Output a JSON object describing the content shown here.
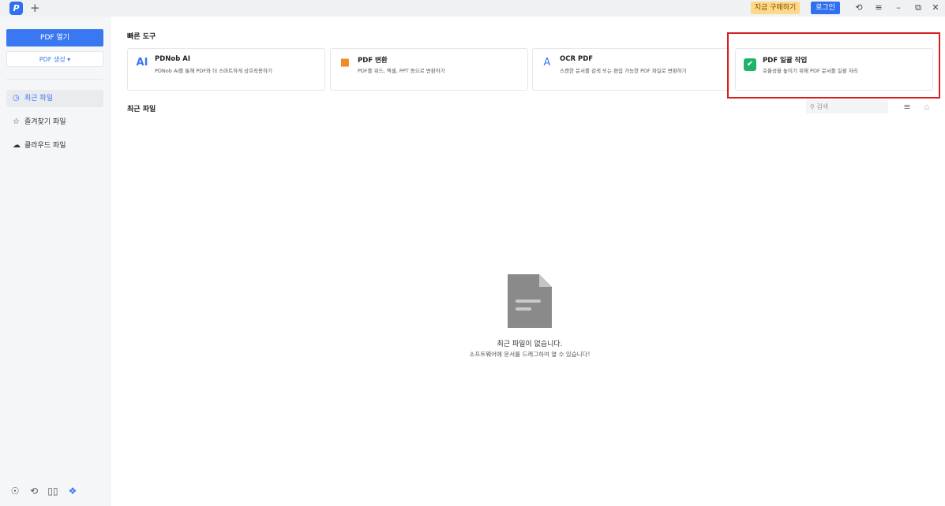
{
  "titlebar": {
    "logo": "P",
    "new_tab": "+",
    "buy_label": "지금 구매하기",
    "login_label": "로그인",
    "icons": [
      "support-icon",
      "menu-icon",
      "minimize-icon",
      "restore-icon",
      "close-icon"
    ],
    "icon_glyphs": [
      "⟲",
      "≡",
      "–",
      "⧉",
      "✕"
    ]
  },
  "sidebar": {
    "open_label": "PDF 열기",
    "create_label": "PDF 생성 ▾",
    "nav": [
      {
        "icon": "◷",
        "label": "최근 파일"
      },
      {
        "icon": "☆",
        "label": "즐겨찾기 파일"
      },
      {
        "icon": "☁",
        "label": "클라우드 파일"
      }
    ],
    "bottom_icons": [
      "☉",
      "⟲",
      "▯▯",
      "❖"
    ]
  },
  "quick_tools": {
    "title": "빠른 도구",
    "cards": [
      {
        "icon": "AI",
        "title": "PDNob AI",
        "desc": "PDNob AI를 통해 PDF와 더 스마트하게 상호작용하기",
        "color": "#3a78f2"
      },
      {
        "icon": "■",
        "title": "PDF 변환",
        "desc": "PDF를 워드, 엑셀, PPT 등으로 변환하기",
        "color": "#f08a24"
      },
      {
        "icon": "A",
        "title": "OCR PDF",
        "desc": "스캔한 문서를 검색 또는 편집 가능한 PDF 파일로 변환하기",
        "color": "#3a78f2"
      },
      {
        "icon": "✔",
        "title": "PDF 일괄 작업",
        "desc": "효율성을 높이기 위해 PDF 문서를 일괄 처리",
        "color": "#22b36b"
      }
    ]
  },
  "recent": {
    "title": "최근 파일",
    "search_placeholder": "⚲ 검색",
    "empty_title": "최근 파일이 없습니다.",
    "empty_sub": "소프트웨어에 문서를 드래그하여 열 수 있습니다!"
  }
}
